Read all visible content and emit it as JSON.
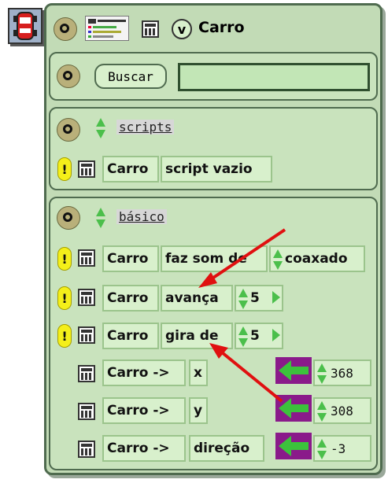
{
  "header": {
    "v_label": "v",
    "object_name": "Carro"
  },
  "search": {
    "button_label": "Buscar",
    "value": ""
  },
  "scripts_section": {
    "category": "scripts",
    "row": {
      "object": "Carro",
      "command": "script vazio"
    }
  },
  "basic_section": {
    "category": "básico",
    "commands": [
      {
        "object": "Carro",
        "command": "faz som de",
        "arg": "coaxado"
      },
      {
        "object": "Carro",
        "command": "avança",
        "arg": "5"
      },
      {
        "object": "Carro",
        "command": "gira de",
        "arg": "5"
      }
    ],
    "properties": [
      {
        "object": "Carro ->",
        "name": "x",
        "value": "368"
      },
      {
        "object": "Carro ->",
        "name": "y",
        "value": "308"
      },
      {
        "object": "Carro ->",
        "name": "direção",
        "value": "-3"
      }
    ]
  },
  "bang_label": "!",
  "colors": {
    "panel": "#c2dbb6",
    "tile": "#d8f0cc",
    "arrow_bg": "#8a1a8a",
    "arrow": "#3cc23c",
    "annotation_arrow": "#e01010"
  }
}
